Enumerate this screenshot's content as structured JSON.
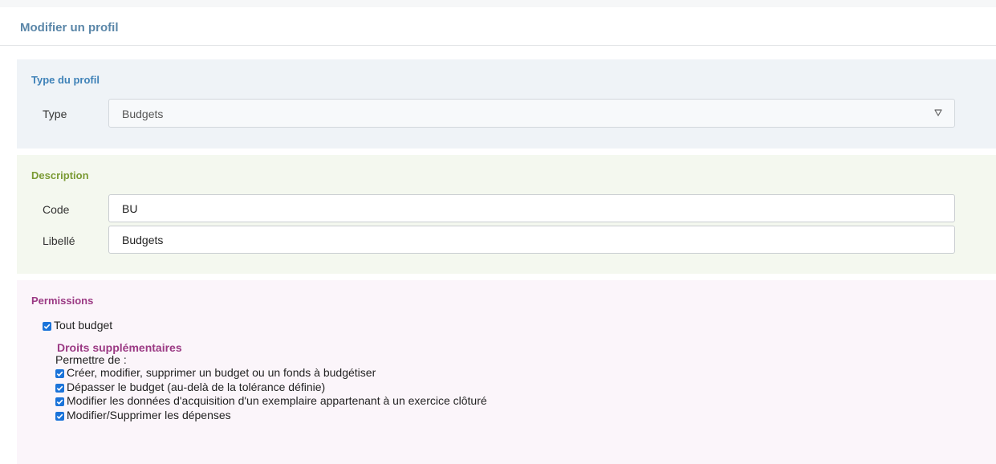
{
  "page": {
    "title": "Modifier un profil"
  },
  "type_section": {
    "title": "Type du profil",
    "type_label": "Type",
    "type_value": "Budgets"
  },
  "description_section": {
    "title": "Description",
    "code_label": "Code",
    "code_value": "BU",
    "libelle_label": "Libellé",
    "libelle_value": "Budgets"
  },
  "permissions_section": {
    "title": "Permissions",
    "tout_budget": {
      "label": "Tout budget",
      "checked": true
    },
    "extra_title": "Droits supplémentaires",
    "extra_intro": "Permettre de :",
    "items": [
      {
        "label": "Créer, modifier, supprimer un budget ou un fonds à budgétiser",
        "checked": true
      },
      {
        "label": "Dépasser le budget (au-delà de la tolérance définie)",
        "checked": true
      },
      {
        "label": "Modifier les données d'acquisition d'un exemplaire appartenant à un exercice clôturé",
        "checked": true
      },
      {
        "label": "Modifier/Supprimer les dépenses",
        "checked": true
      }
    ]
  },
  "colors": {
    "accent_blue": "#3f82b8",
    "accent_green": "#7b9b35",
    "accent_purple": "#9b3a84",
    "checkbox": "#1a73d9"
  }
}
